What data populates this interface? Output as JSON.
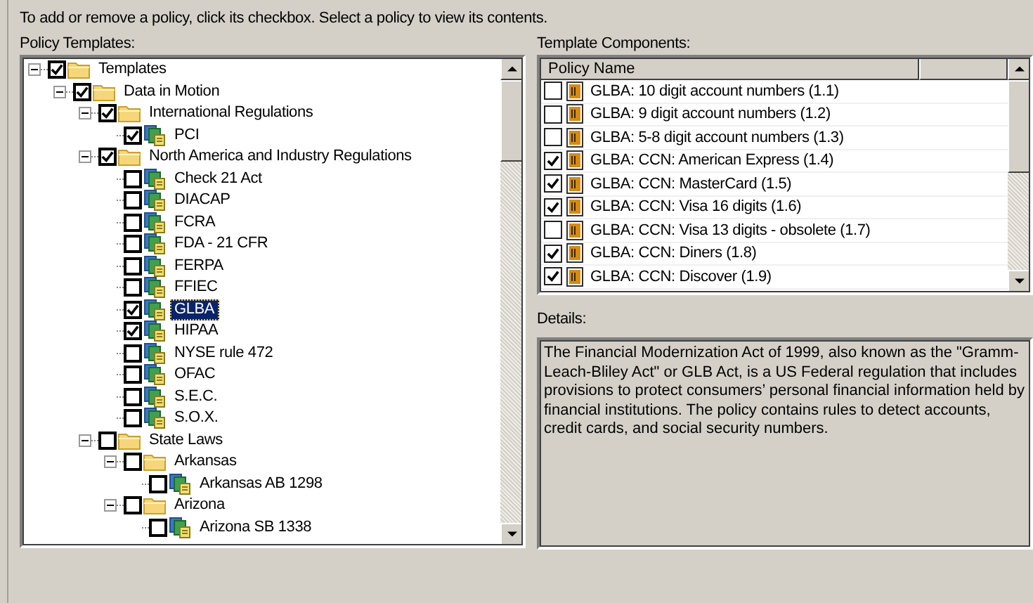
{
  "instruction": "To add or remove a policy, click its checkbox. Select a policy to view its contents.",
  "policy_templates": {
    "label": "Policy Templates:",
    "items": [
      {
        "label": "Templates",
        "kind": "folder",
        "checked": true,
        "expanded": true,
        "selected": false,
        "children": [
          {
            "label": "Data in Motion",
            "kind": "folder",
            "checked": true,
            "expanded": true,
            "selected": false,
            "children": [
              {
                "label": "International Regulations",
                "kind": "folder",
                "checked": true,
                "expanded": true,
                "selected": false,
                "children": [
                  {
                    "label": "PCI",
                    "kind": "policy",
                    "checked": true,
                    "selected": false
                  }
                ]
              },
              {
                "label": "North America and Industry Regulations",
                "kind": "folder",
                "checked": true,
                "expanded": true,
                "selected": false,
                "children": [
                  {
                    "label": "Check 21 Act",
                    "kind": "policy",
                    "checked": false,
                    "selected": false
                  },
                  {
                    "label": "DIACAP",
                    "kind": "policy",
                    "checked": false,
                    "selected": false
                  },
                  {
                    "label": "FCRA",
                    "kind": "policy",
                    "checked": false,
                    "selected": false
                  },
                  {
                    "label": "FDA - 21 CFR",
                    "kind": "policy",
                    "checked": false,
                    "selected": false
                  },
                  {
                    "label": "FERPA",
                    "kind": "policy",
                    "checked": false,
                    "selected": false
                  },
                  {
                    "label": "FFIEC",
                    "kind": "policy",
                    "checked": false,
                    "selected": false
                  },
                  {
                    "label": "GLBA",
                    "kind": "policy",
                    "checked": true,
                    "selected": true
                  },
                  {
                    "label": "HIPAA",
                    "kind": "policy",
                    "checked": true,
                    "selected": false
                  },
                  {
                    "label": "NYSE rule 472",
                    "kind": "policy",
                    "checked": false,
                    "selected": false
                  },
                  {
                    "label": "OFAC",
                    "kind": "policy",
                    "checked": false,
                    "selected": false
                  },
                  {
                    "label": "S.E.C.",
                    "kind": "policy",
                    "checked": false,
                    "selected": false
                  },
                  {
                    "label": "S.O.X.",
                    "kind": "policy",
                    "checked": false,
                    "selected": false
                  }
                ]
              },
              {
                "label": "State Laws",
                "kind": "folder",
                "checked": false,
                "expanded": true,
                "selected": false,
                "children": [
                  {
                    "label": "Arkansas",
                    "kind": "folder",
                    "checked": false,
                    "expanded": true,
                    "selected": false,
                    "children": [
                      {
                        "label": "Arkansas AB 1298",
                        "kind": "policy",
                        "checked": false,
                        "selected": false
                      }
                    ]
                  },
                  {
                    "label": "Arizona",
                    "kind": "folder",
                    "checked": false,
                    "expanded": true,
                    "selected": false,
                    "children": [
                      {
                        "label": "Arizona SB 1338",
                        "kind": "policy",
                        "checked": false,
                        "selected": false
                      }
                    ]
                  }
                ]
              }
            ]
          }
        ]
      }
    ]
  },
  "template_components": {
    "label": "Template Components:",
    "columns": [
      "Policy Name"
    ],
    "rows": [
      {
        "name": "GLBA: 10 digit account numbers (1.1)",
        "checked": false
      },
      {
        "name": "GLBA: 9 digit account numbers (1.2)",
        "checked": false
      },
      {
        "name": "GLBA: 5-8 digit account numbers (1.3)",
        "checked": false
      },
      {
        "name": "GLBA: CCN: American Express (1.4)",
        "checked": true
      },
      {
        "name": "GLBA: CCN: MasterCard (1.5)",
        "checked": true
      },
      {
        "name": "GLBA: CCN: Visa 16 digits (1.6)",
        "checked": true
      },
      {
        "name": "GLBA: CCN: Visa 13 digits - obsolete (1.7)",
        "checked": false
      },
      {
        "name": "GLBA: CCN: Diners (1.8)",
        "checked": true
      },
      {
        "name": "GLBA: CCN: Discover (1.9)",
        "checked": true
      }
    ]
  },
  "details": {
    "label": "Details:",
    "text": "The Financial Modernization Act of 1999, also known as the \"Gramm-Leach-Bliley Act\" or GLB Act, is a US Federal regulation that includes provisions to protect consumers’ personal financial information held by financial institutions. The policy contains rules to detect accounts, credit cards, and social security numbers."
  }
}
